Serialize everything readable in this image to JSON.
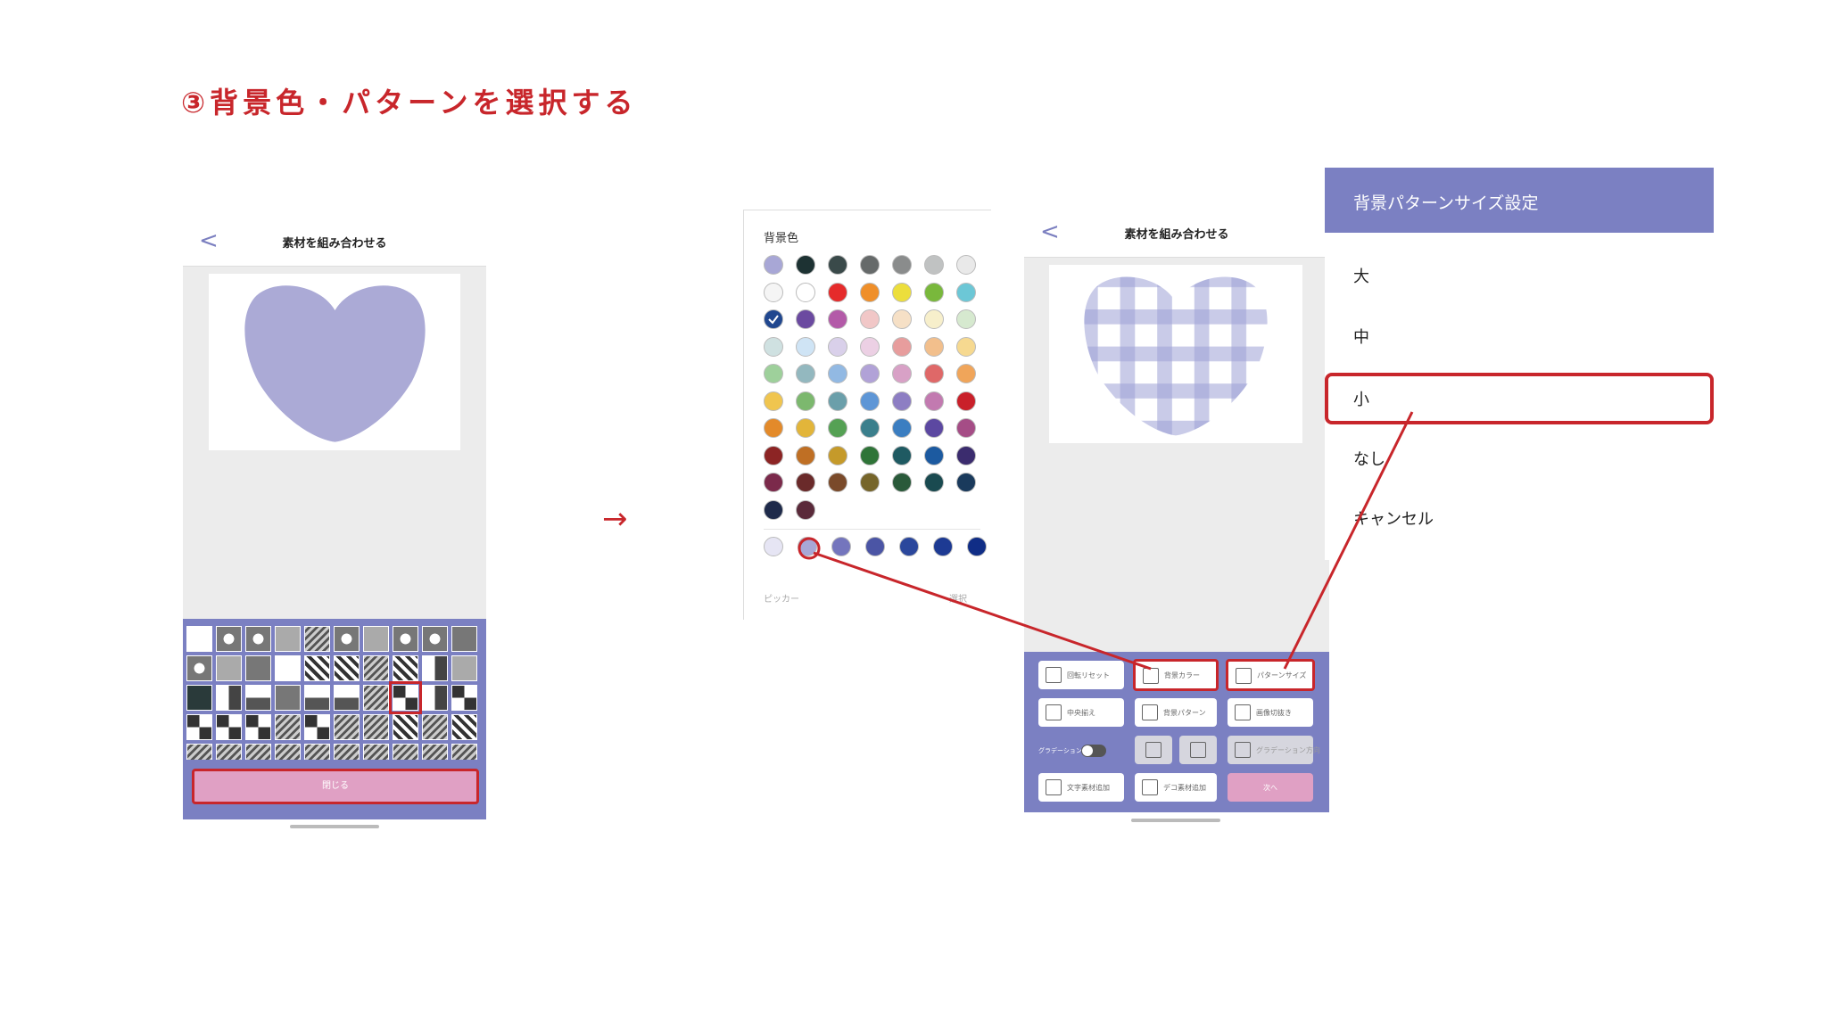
{
  "title": "③背景色・パターンを選択する",
  "arrow": "→",
  "phone1": {
    "back": "<",
    "header_title": "素材を組み合わせる",
    "close_label": "閉じる",
    "heart_color": "#abaad6"
  },
  "color_panel": {
    "label": "背景色",
    "picker_label": "ピッカー",
    "select_label": "選択",
    "palette": [
      [
        "#a8a7d6",
        "#1d3233",
        "#3a4a4a",
        "#666a6a",
        "#8a8c8c",
        "#c0c2c2",
        "#e9e9e9"
      ],
      [
        "#f5f5f5",
        "#ffffff",
        "#e52b2b",
        "#ef8f2a",
        "#ecde3c",
        "#79b83c",
        "#6cc7d6"
      ],
      [
        "#20478f",
        "#6b4aa0",
        "#b35aa8",
        "#f1c7c7",
        "#f6e0c6",
        "#f7efcb",
        "#d6e9cf"
      ],
      [
        "#cfe1e1",
        "#cfe4f5",
        "#d9d0ea",
        "#ecd0e4",
        "#e79d9d",
        "#f2bf8c",
        "#f6d990"
      ],
      [
        "#9ed09b",
        "#93b8bf",
        "#92b9e3",
        "#b1a2d7",
        "#d8a1c6",
        "#df6868",
        "#f0a55a"
      ],
      [
        "#f0c54f",
        "#7cb86e",
        "#6b9faa",
        "#5e96d6",
        "#8d7ec3",
        "#c27ab0",
        "#c9202a"
      ],
      [
        "#e38a2a",
        "#e2b53a",
        "#55a154",
        "#3b7f8c",
        "#3b7ec1",
        "#5c48a1",
        "#a54d86"
      ],
      [
        "#8c2424",
        "#bf6f24",
        "#c59a2a",
        "#2f7438",
        "#1f5a62",
        "#1c5aa0",
        "#3b2c6e"
      ],
      [
        "#7b2a4b",
        "#6a2a2a",
        "#7a4a2a",
        "#76652a",
        "#2a5a3a",
        "#1a4a50",
        "#1a3a5c"
      ],
      [
        "#1e2a4a",
        "#5a2a3a"
      ]
    ],
    "selected_swatch": "#20478f",
    "tones": [
      "#e6e5f4",
      "#a8a7d6",
      "#7475bd",
      "#4b55a5",
      "#2b479c",
      "#1d3a93",
      "#102d86"
    ]
  },
  "phone2": {
    "back": "<",
    "header_title": "素材を組み合わせる",
    "buttons": {
      "rotate_reset": "回転リセット",
      "bg_color": "背景カラー",
      "pattern_size": "パターンサイズ",
      "center_align": "中央揃え",
      "bg_pattern": "背景パターン",
      "crop": "画像切抜き",
      "gradient_toggle": "グラデーション",
      "gradient_dir": "グラデーション方向",
      "add_text": "文字素材追加",
      "add_deco": "デコ素材追加",
      "next": "次へ"
    },
    "check_color": "#9da0d4"
  },
  "size_menu": {
    "header": "背景パターンサイズ設定",
    "items": [
      "大",
      "中",
      "小",
      "なし",
      "キャンセル"
    ]
  },
  "accent": "#c8262b",
  "brand": "#7b80c2"
}
